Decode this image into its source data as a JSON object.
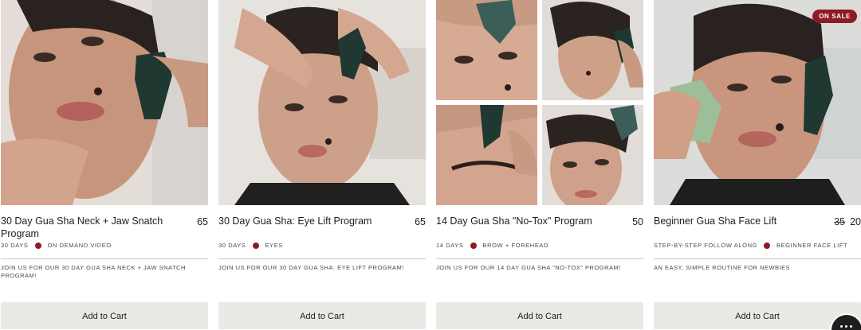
{
  "products": [
    {
      "title": "30 Day Gua Sha Neck + Jaw Snatch Program",
      "price": "65",
      "meta_left": "30 DAYS",
      "meta_right": "ON DEMAND VIDEO",
      "description": "JOIN US FOR OUR 30 DAY GUA SHA  NECK + JAW SNATCH PROGRAM!",
      "button_label": "Add to Cart"
    },
    {
      "title": "30 Day Gua Sha: Eye Lift Program",
      "price": "65",
      "meta_left": "30 DAYS",
      "meta_right": "EYES",
      "description": "JOIN US FOR OUR 30 DAY GUA SHA: EYE LIFT PROGRAM!",
      "button_label": "Add to Cart"
    },
    {
      "title": "14 Day Gua Sha \"No-Tox\" Program",
      "price": "50",
      "meta_left": "14 DAYS",
      "meta_right": "BROW + FOREHEAD",
      "description": "JOIN US FOR OUR 14 DAY GUA SHA \"NO-TOX\" PROGRAM!",
      "button_label": "Add to Cart"
    },
    {
      "title": "Beginner Gua Sha Face Lift",
      "price_original": "35",
      "price": "20",
      "badge": "ON SALE",
      "meta_left": "STEP-BY-STEP FOLLOW ALONG",
      "meta_right": "BEGINNER FACE LIFT",
      "description": "AN EASY, SIMPLE ROUTINE FOR NEWBIES",
      "button_label": "Add to Cart"
    }
  ],
  "icons": {
    "meta_separator": "dot-icon",
    "chat": "chat-bubble-icon"
  },
  "colors": {
    "accent": "#8c1c22",
    "button_bg": "#e9e9e6",
    "text": "#1e1e1e"
  }
}
